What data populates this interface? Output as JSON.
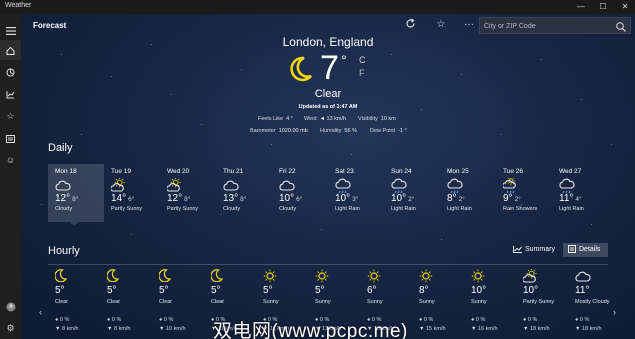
{
  "window": {
    "title": "Weather",
    "minimize": "—",
    "maximize": "☐",
    "close": "✕"
  },
  "header": {
    "title": "Forecast",
    "more": "···",
    "search_placeholder": "City or ZIP Code"
  },
  "current": {
    "location": "London, England",
    "temperature": "7",
    "degree": "°",
    "unit_c": "C",
    "unit_f": "F",
    "condition": "Clear",
    "updated": "Updated as of 1:47 AM",
    "feels_like_label": "Feels Like",
    "feels_like": "4 °",
    "wind_label": "Wind",
    "wind": "◄ 13 km/h",
    "visibility_label": "Visibility",
    "visibility": "10 km",
    "barometer_label": "Barometer",
    "barometer": "1020.00 mb",
    "humidity_label": "Humidity",
    "humidity": "56 %",
    "dewpoint_label": "Dew Point",
    "dewpoint": "-1 °"
  },
  "daily": {
    "label": "Daily",
    "days": [
      {
        "name": "Mon 18",
        "hi": "12°",
        "lo": "8°",
        "cond": "Cloudy",
        "icon": "cloudy"
      },
      {
        "name": "Tue 19",
        "hi": "14°",
        "lo": "6°",
        "cond": "Partly Sunny",
        "icon": "partly-sunny"
      },
      {
        "name": "Wed 20",
        "hi": "12°",
        "lo": "8°",
        "cond": "Partly Sunny",
        "icon": "partly-sunny"
      },
      {
        "name": "Thu 21",
        "hi": "13°",
        "lo": "8°",
        "cond": "Cloudy",
        "icon": "cloudy"
      },
      {
        "name": "Fri 22",
        "hi": "10°",
        "lo": "6°",
        "cond": "Cloudy",
        "icon": "cloudy"
      },
      {
        "name": "Sat 23",
        "hi": "10°",
        "lo": "3°",
        "cond": "Light Rain",
        "icon": "rain"
      },
      {
        "name": "Sun 24",
        "hi": "10°",
        "lo": "2°",
        "cond": "Light Rain",
        "icon": "rain"
      },
      {
        "name": "Mon 25",
        "hi": "8°",
        "lo": "2°",
        "cond": "Light Rain",
        "icon": "rain"
      },
      {
        "name": "Tue 26",
        "hi": "9°",
        "lo": "2°",
        "cond": "Rain Showers",
        "icon": "rain-showers"
      },
      {
        "name": "Wed 27",
        "hi": "11°",
        "lo": "4°",
        "cond": "Light Rain",
        "icon": "rain"
      }
    ]
  },
  "hourly": {
    "label": "Hourly",
    "summary_label": "Summary",
    "details_label": "Details",
    "hours": [
      {
        "temp": "5°",
        "cond": "Clear",
        "precip": "0 %",
        "wind": "8 km/h",
        "icon": "moon"
      },
      {
        "temp": "5°",
        "cond": "Clear",
        "precip": "0 %",
        "wind": "8 km/h",
        "icon": "moon"
      },
      {
        "temp": "5°",
        "cond": "Clear",
        "precip": "0 %",
        "wind": "10 km/h",
        "icon": "moon"
      },
      {
        "temp": "5°",
        "cond": "Clear",
        "precip": "0 %",
        "wind": "11 km/h",
        "icon": "moon"
      },
      {
        "temp": "5°",
        "cond": "Sunny",
        "precip": "0 %",
        "wind": "11 km/h",
        "icon": "sun"
      },
      {
        "temp": "5°",
        "cond": "Sunny",
        "precip": "0 %",
        "wind": "11 km/h",
        "icon": "sun"
      },
      {
        "temp": "6°",
        "cond": "Sunny",
        "precip": "0 %",
        "wind": "13 km/h",
        "icon": "sun"
      },
      {
        "temp": "8°",
        "cond": "Sunny",
        "precip": "0 %",
        "wind": "15 km/h",
        "icon": "sun"
      },
      {
        "temp": "10°",
        "cond": "Sunny",
        "precip": "0 %",
        "wind": "16 km/h",
        "icon": "sun"
      },
      {
        "temp": "10°",
        "cond": "Partly Sunny",
        "precip": "0 %",
        "wind": "18 km/h",
        "icon": "partly-sunny"
      },
      {
        "temp": "11°",
        "cond": "Mostly Cloudy",
        "precip": "0 %",
        "wind": "18 km/h",
        "icon": "cloudy"
      }
    ]
  },
  "watermark": "双电网(www.pcpc.me)"
}
